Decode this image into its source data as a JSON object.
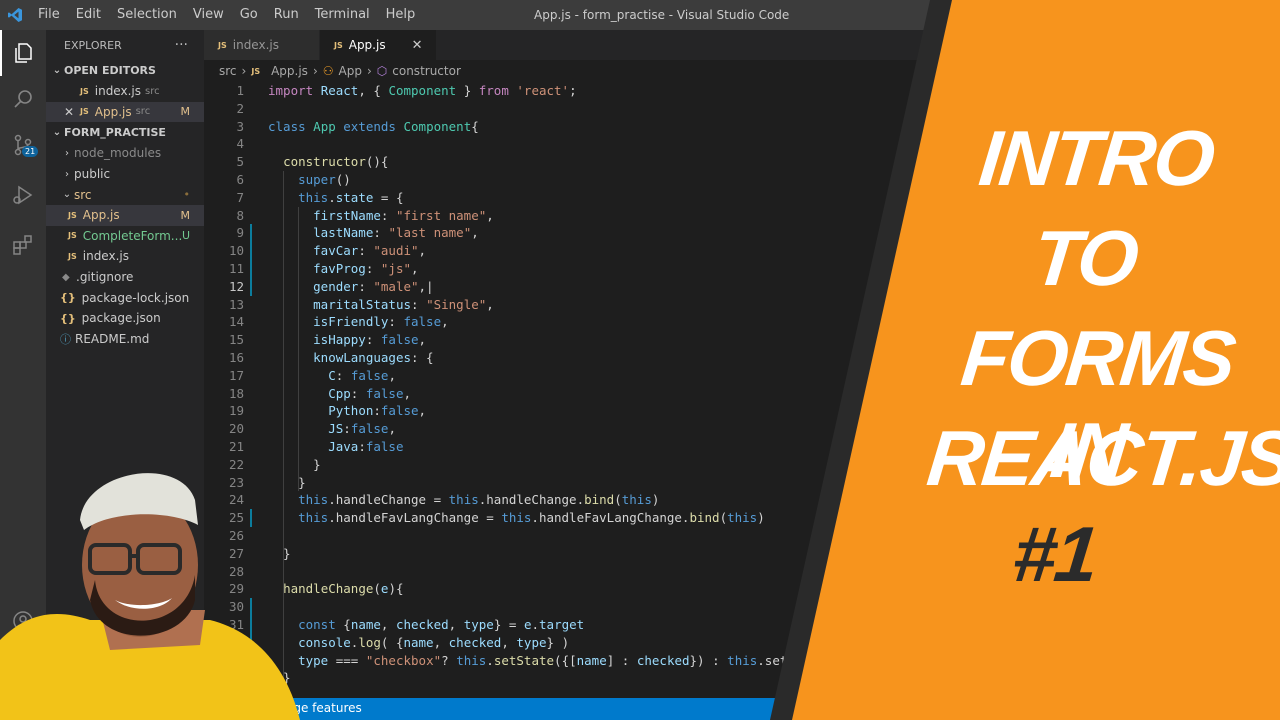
{
  "window": {
    "title": "App.js - form_practise - Visual Studio Code"
  },
  "menu": [
    "File",
    "Edit",
    "Selection",
    "View",
    "Go",
    "Run",
    "Terminal",
    "Help"
  ],
  "activity_bar": {
    "scm_badge": "21"
  },
  "explorer": {
    "title": "EXPLORER",
    "more": "···",
    "open_editors": {
      "label": "OPEN EDITORS",
      "items": [
        {
          "name": "index.js",
          "dir": "src",
          "status": ""
        },
        {
          "name": "App.js",
          "dir": "src",
          "status": "M"
        }
      ]
    },
    "project": {
      "label": "FORM_PRACTISE",
      "items": [
        {
          "name": "node_modules",
          "status": ""
        },
        {
          "name": "public",
          "status": ""
        },
        {
          "name": "src",
          "status": "•"
        },
        {
          "name": "App.js",
          "status": "M"
        },
        {
          "name": "CompleteForm...",
          "status": "U"
        },
        {
          "name": "index.js",
          "status": ""
        },
        {
          "name": ".gitignore",
          "status": ""
        },
        {
          "name": "package-lock.json",
          "status": ""
        },
        {
          "name": "package.json",
          "status": ""
        },
        {
          "name": "README.md",
          "status": ""
        }
      ]
    }
  },
  "tabs": [
    {
      "label": "index.js",
      "active": false
    },
    {
      "label": "App.js",
      "active": true,
      "close": "✕"
    }
  ],
  "breadcrumb": [
    "src",
    "App.js",
    "App",
    "constructor"
  ],
  "editor": {
    "current_line": 12,
    "lines": [
      {
        "n": "1",
        "code": "import React, { Component } from 'react';"
      },
      {
        "n": "2",
        "code": ""
      },
      {
        "n": "3",
        "code": "class App extends Component{"
      },
      {
        "n": "4",
        "code": ""
      },
      {
        "n": "5",
        "code": "  constructor(){"
      },
      {
        "n": "6",
        "code": "    super()"
      },
      {
        "n": "7",
        "code": "    this.state = {"
      },
      {
        "n": "8",
        "code": "      firstName: \"first name\","
      },
      {
        "n": "9",
        "code": "      lastName: \"last name\","
      },
      {
        "n": "10",
        "code": "      favCar: \"audi\","
      },
      {
        "n": "11",
        "code": "      favProg: \"js\","
      },
      {
        "n": "12",
        "code": "      gender: \"male\",|"
      },
      {
        "n": "13",
        "code": "      maritalStatus: \"Single\","
      },
      {
        "n": "14",
        "code": "      isFriendly: false,"
      },
      {
        "n": "15",
        "code": "      isHappy: false,"
      },
      {
        "n": "16",
        "code": "      knowLanguages: {"
      },
      {
        "n": "17",
        "code": "        C: false,"
      },
      {
        "n": "18",
        "code": "        Cpp: false,"
      },
      {
        "n": "19",
        "code": "        Python:false,"
      },
      {
        "n": "20",
        "code": "        JS:false,"
      },
      {
        "n": "21",
        "code": "        Java:false"
      },
      {
        "n": "22",
        "code": "      }"
      },
      {
        "n": "23",
        "code": "    }"
      },
      {
        "n": "24",
        "code": "    this.handleChange = this.handleChange.bind(this)"
      },
      {
        "n": "25",
        "code": "    this.handleFavLangChange = this.handleFavLangChange.bind(this)"
      },
      {
        "n": "26",
        "code": ""
      },
      {
        "n": "27",
        "code": "  }"
      },
      {
        "n": "28",
        "code": ""
      },
      {
        "n": "29",
        "code": "  handleChange(e){"
      },
      {
        "n": "30",
        "code": ""
      },
      {
        "n": "31",
        "code": "    const {name, checked, type} = e.target"
      },
      {
        "n": "32",
        "code": "    console.log( {name, checked, type} )"
      },
      {
        "n": "33",
        "code": "    type === \"checkbox\"? this.setState({[name] : checked}) : this.setSta"
      },
      {
        "n": "34",
        "code": "  }"
      }
    ]
  },
  "status_bar": {
    "text": "age features"
  },
  "banner": {
    "lines": [
      "INTRO",
      "TO",
      "FORMS IN",
      "REACT.JS"
    ],
    "episode": "#1",
    "color": "#f7941d"
  }
}
